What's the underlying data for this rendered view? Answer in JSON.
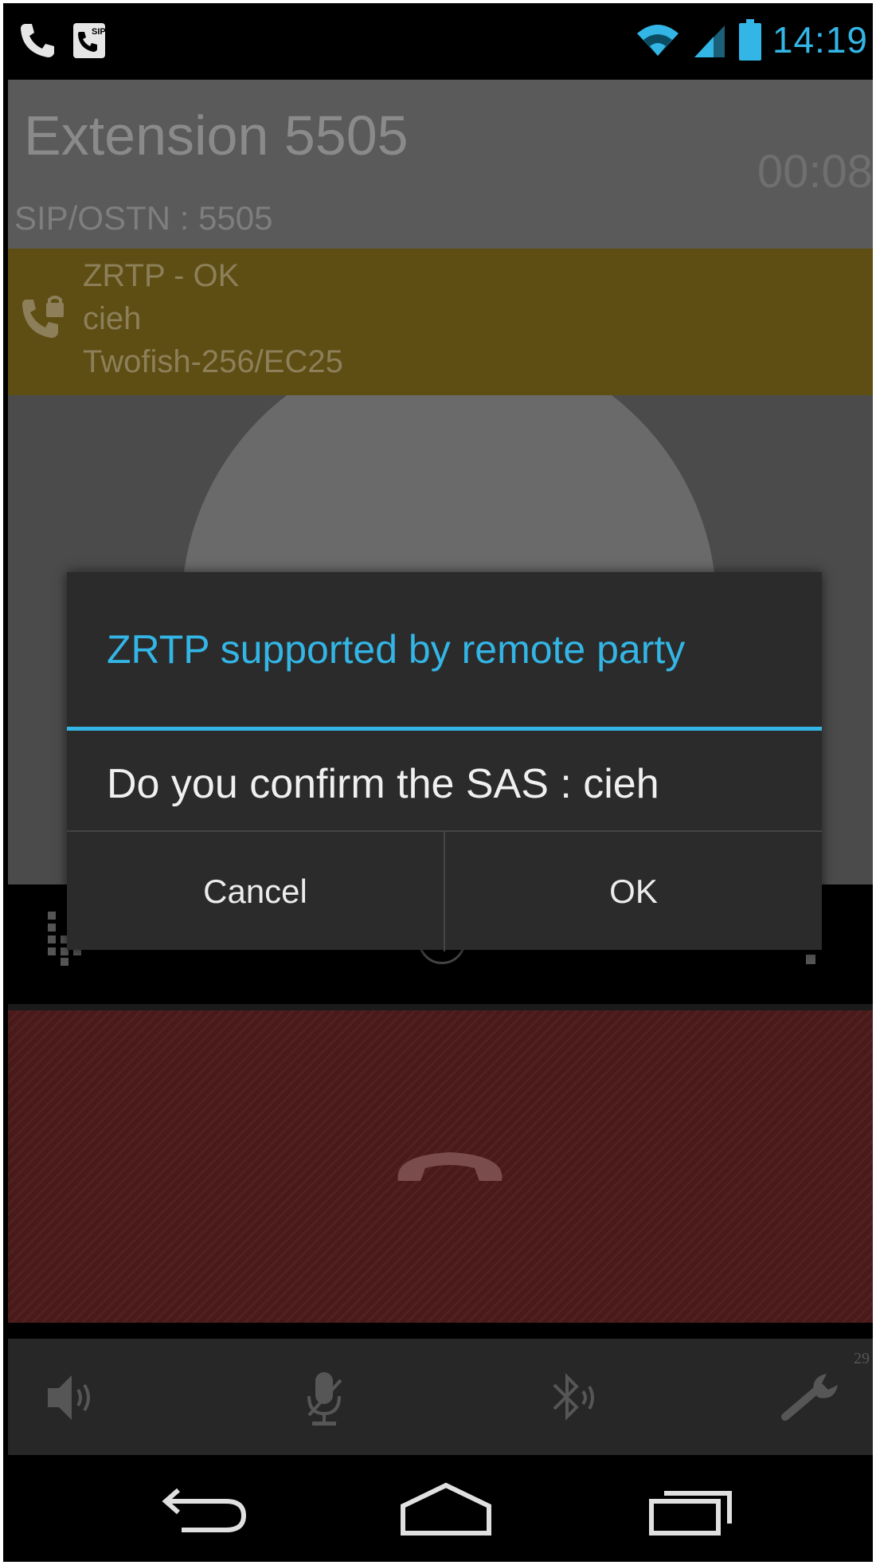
{
  "status_bar": {
    "time": "14:19",
    "icons": [
      "phone-icon",
      "sip-icon",
      "wifi-icon",
      "cell-signal-icon",
      "battery-icon"
    ],
    "accent_color": "#33b5e5"
  },
  "call": {
    "contact_name": "Extension 5505",
    "sip_address": "SIP/OSTN : 5505",
    "duration": "00:08"
  },
  "zrtp_banner": {
    "status": "ZRTP - OK",
    "sas": "cieh",
    "cipher": "Twofish-256/EC25",
    "background_color": "#5e4e14"
  },
  "dialog": {
    "title": "ZRTP supported by remote party",
    "message": "Do you confirm the SAS : cieh",
    "cancel_label": "Cancel",
    "ok_label": "OK"
  },
  "toolbar": {
    "items": [
      "speaker-icon",
      "mute-mic-icon",
      "bluetooth-icon",
      "settings-wrench-icon"
    ],
    "badge": "29"
  },
  "nav_bar": {
    "items": [
      "back-icon",
      "home-icon",
      "recent-apps-icon"
    ]
  }
}
